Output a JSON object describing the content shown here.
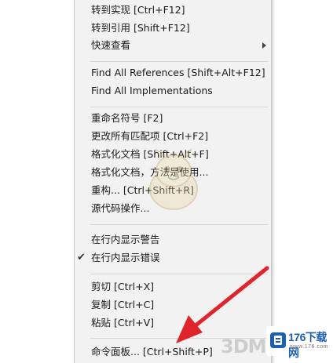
{
  "menu": {
    "items": [
      {
        "label": "转到实现  [Ctrl+F12]"
      },
      {
        "label": "转到引用  [Shift+F12]"
      },
      {
        "label": "快速查看"
      },
      {
        "label": "Find All References  [Shift+Alt+F12]"
      },
      {
        "label": "Find All Implementations"
      },
      {
        "label": "重命名符号  [F2]"
      },
      {
        "label": "更改所有匹配项  [Ctrl+F2]"
      },
      {
        "label": "格式化文档  [Shift+Alt+F]"
      },
      {
        "label": "格式化文档，方法是使用..."
      },
      {
        "label": "重构...  [Ctrl+Shift+R]"
      },
      {
        "label": "源代码操作..."
      },
      {
        "label": "在行内显示警告"
      },
      {
        "label": "在行内显示错误"
      },
      {
        "label": "剪切  [Ctrl+X]"
      },
      {
        "label": "复制  [Ctrl+C]"
      },
      {
        "label": "粘贴  [Ctrl+V]"
      },
      {
        "label": "命令面板...  [Ctrl+Shift+P]"
      }
    ],
    "checkmark": "✔"
  },
  "watermark": {
    "brand": "3DM"
  },
  "site_badge": {
    "text": "176下载网",
    "sub": "www.176.com"
  },
  "colors": {
    "menu_bg": "#f2f2f2",
    "arrow": "#e0242b",
    "badge_text": "#1d5fb0"
  }
}
